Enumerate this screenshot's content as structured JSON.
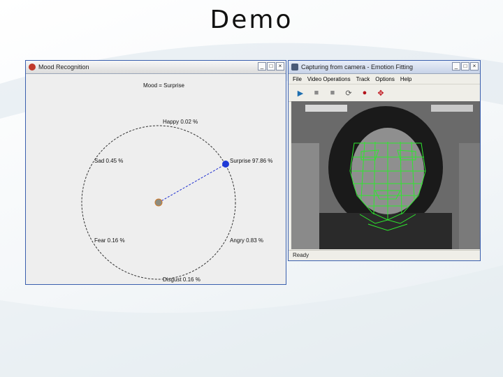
{
  "slide": {
    "title": "Demo"
  },
  "mood_window": {
    "title": "Mood Recognition",
    "mood_label": "Mood = Surprise",
    "emotions": [
      {
        "id": "happy",
        "label": "Happy 0.02 %"
      },
      {
        "id": "surprise",
        "label": "Surprise 97.86 %"
      },
      {
        "id": "angry",
        "label": "Angry 0.83 %"
      },
      {
        "id": "disgust",
        "label": "Disgust 0.16 %"
      },
      {
        "id": "fear",
        "label": "Fear 0.16 %"
      },
      {
        "id": "sad",
        "label": "Sad 0.45 %"
      }
    ],
    "buttons": {
      "minimize": "_",
      "maximize": "□",
      "close": "×"
    }
  },
  "camera_window": {
    "title": "Capturing from camera - Emotion Fitting",
    "menu": [
      "File",
      "Video Operations",
      "Track",
      "Options",
      "Help"
    ],
    "toolbar": [
      {
        "name": "play-icon",
        "glyph": "▶",
        "color": "#1f6fb0"
      },
      {
        "name": "pause-icon",
        "glyph": "■",
        "color": "#8a8a8a"
      },
      {
        "name": "stop-icon",
        "glyph": "■",
        "color": "#8a8a8a"
      },
      {
        "name": "refresh-icon",
        "glyph": "⟳",
        "color": "#555555"
      },
      {
        "name": "record-icon",
        "glyph": "●",
        "color": "#b3121b"
      },
      {
        "name": "move-icon",
        "glyph": "✥",
        "color": "#c0121b"
      }
    ],
    "status": "Ready",
    "buttons": {
      "minimize": "_",
      "maximize": "□",
      "close": "×"
    }
  },
  "colors": {
    "mesh": "#2ee82e",
    "vector": "#2030d0",
    "marker": "#1f3ad6"
  }
}
